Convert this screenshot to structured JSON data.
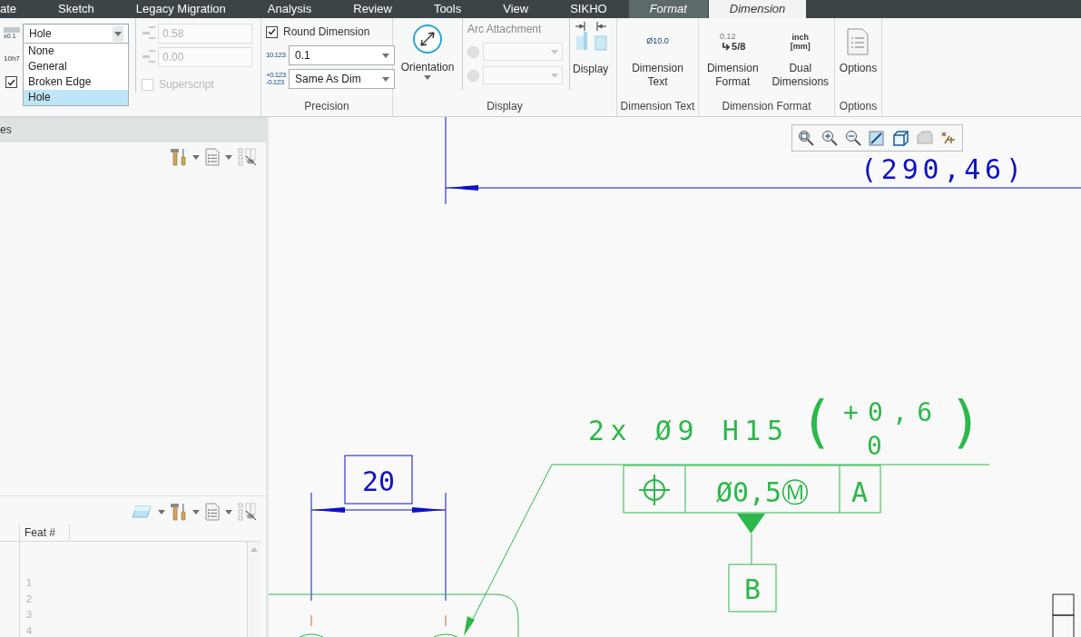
{
  "tabs": [
    {
      "label": "ate",
      "selected": false,
      "contextual": false
    },
    {
      "label": "Sketch",
      "selected": false,
      "contextual": false
    },
    {
      "label": "Legacy Migration",
      "selected": false,
      "contextual": false
    },
    {
      "label": "Analysis",
      "selected": false,
      "contextual": false
    },
    {
      "label": "Review",
      "selected": false,
      "contextual": false
    },
    {
      "label": "Tools",
      "selected": false,
      "contextual": false
    },
    {
      "label": "View",
      "selected": false,
      "contextual": false
    },
    {
      "label": "SIKHO",
      "selected": false,
      "contextual": false
    },
    {
      "label": "Format",
      "selected": false,
      "contextual": true
    },
    {
      "label": "Dimension",
      "selected": true,
      "contextual": true
    }
  ],
  "tolerance_group": {
    "table_icon_text": "±0.1",
    "mode_select": {
      "value": "Hole",
      "open": true
    },
    "dropdown_items": [
      {
        "label": "None",
        "selected": false
      },
      {
        "label": "General",
        "selected": false
      },
      {
        "label": "Broken Edge",
        "selected": false
      },
      {
        "label": "Hole",
        "selected": true
      }
    ],
    "fit_icon_text": "10h7",
    "checkbox": {
      "checked": true
    },
    "upper_field": {
      "value": "0.58",
      "disabled": true
    },
    "lower_field": {
      "value": "0.00",
      "disabled": true
    },
    "superscript": {
      "label": "Superscript",
      "checked": false,
      "disabled": true
    }
  },
  "precision_group": {
    "round_dimension": {
      "label": "Round Dimension",
      "checked": true
    },
    "decimal_icon_text": "10.123",
    "decimal_select": {
      "value": "0.1"
    },
    "tolerance_icon_text": [
      "+0.123",
      "-0.123"
    ],
    "tolerance_select": {
      "value": "Same As Dim"
    },
    "label": "Precision"
  },
  "display_group": {
    "orientation": {
      "label": "Orientation"
    },
    "arc_attachment": {
      "label": "Arc Attachment",
      "disabled": true
    },
    "display_button": {
      "label": "Display"
    },
    "label": "Display"
  },
  "dimension_text_group": {
    "icon_text": "Ø10.0",
    "button": "Dimension Text",
    "label": "Dimension Text"
  },
  "dimension_format_group": {
    "format_icon_text": [
      "0.12",
      "5/8"
    ],
    "format_button": "Dimension Format",
    "dual_icon_text": [
      "inch",
      "[mm]"
    ],
    "dual_button": "Dual Dimensions",
    "label": "Dimension Format"
  },
  "options_group": {
    "button": "Options",
    "label": "Options"
  },
  "left_panel": {
    "header": "es",
    "columns": [
      {
        "label": "Feat #"
      }
    ],
    "rows": [
      "1",
      "2",
      "3",
      "4"
    ]
  },
  "canvas": {
    "coordinate": "(290,46)",
    "dimension": "20",
    "callout": "2x Ø9 H15",
    "paren_open": "(",
    "upper_deviation": "+0,6",
    "lower_deviation": "0",
    "paren_close": ")",
    "frame_cells": [
      {
        "kind": "symbol"
      },
      {
        "kind": "text",
        "text": "Ø0,5Ⓜ"
      },
      {
        "kind": "text",
        "text": "A"
      }
    ],
    "datum": "B"
  }
}
